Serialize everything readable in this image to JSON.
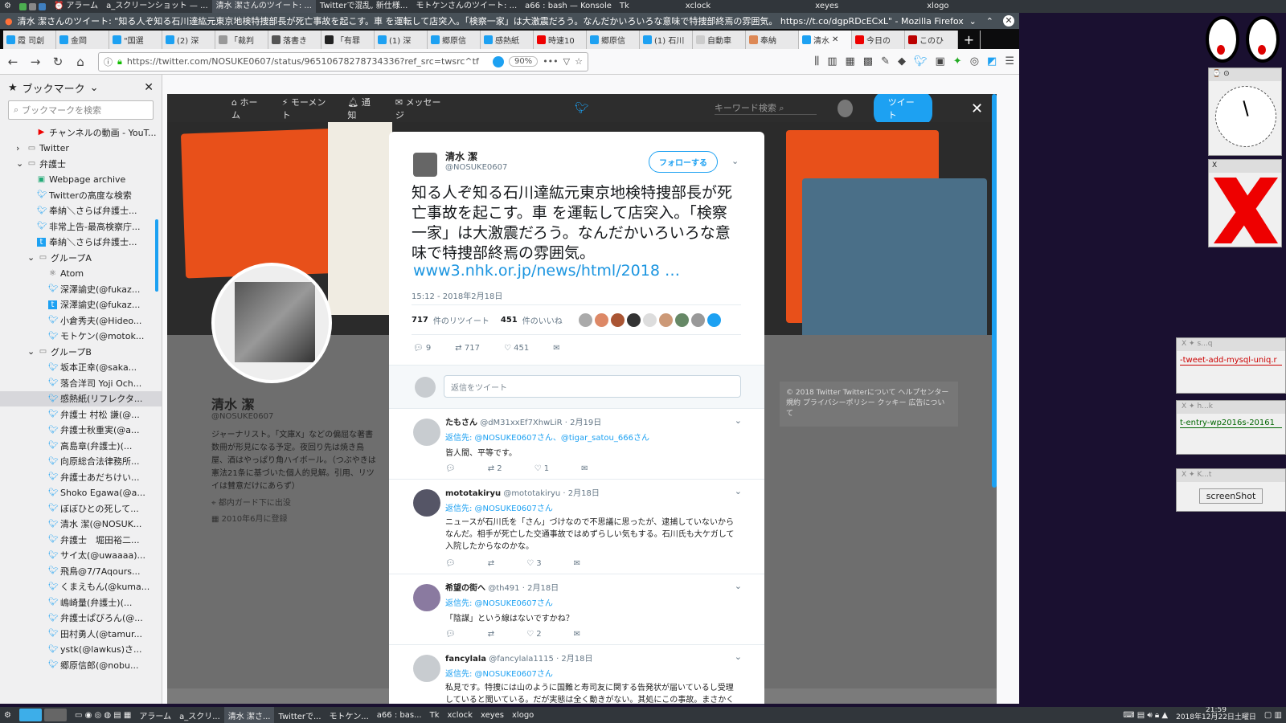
{
  "system_panel": {
    "items": [
      "アラーム",
      "a_スクリーンショット — ...",
      "清水 潔さんのツイート: ...",
      "Twitterで混乱, 新仕様...",
      "モトケンさんのツイート: ...",
      "a66 : bash — Konsole",
      "Tk",
      "xclock",
      "xeyes",
      "xlogo"
    ]
  },
  "window": {
    "title": "清水 潔さんのツイート: \"知る人ぞ知る石川達紘元東京地検特捜部長が死亡事故を起こす。車 を運転して店突入。「検察一家」は大激震だろう。なんだかいろいろな意味で特捜部終焉の雰囲気。 https://t.co/dgpRDcECxL\" - Mozilla Firefox"
  },
  "tabs": [
    "霞 司創",
    "金岡",
    "\"国選",
    "(2) 深",
    "「裁判",
    "落書き",
    "「有罪",
    "(1) 深",
    "郷原信",
    "感熱紙",
    "時速10",
    "郷原信",
    "(1) 石川",
    "自動車",
    "奉納",
    "清水",
    "今日の",
    "このひ"
  ],
  "navbar": {
    "url": "https://twitter.com/NOSUKE0607/status/965106782787343​36?ref_src=twsrc^tf",
    "zoom": "90%"
  },
  "sidebar": {
    "title": "ブックマーク",
    "search_placeholder": "ブックマークを検索",
    "items": [
      {
        "label": "チャンネルの動画 - YouT...",
        "indent": 3,
        "icon": "youtube"
      },
      {
        "label": "Twitter",
        "indent": 2,
        "icon": "folder"
      },
      {
        "label": "弁護士",
        "indent": 2,
        "icon": "folder-open"
      },
      {
        "label": "Webpage archive",
        "indent": 3,
        "icon": "archive"
      },
      {
        "label": "Twitterの高度な検索",
        "indent": 3,
        "icon": "twitter"
      },
      {
        "label": "奉納＼さらば弁護士...",
        "indent": 3,
        "icon": "twitter"
      },
      {
        "label": "非常上告-最高検察庁...",
        "indent": 3,
        "icon": "twitter"
      },
      {
        "label": "奉納＼さらば弁護士...",
        "indent": 3,
        "icon": "t"
      },
      {
        "label": "グループA",
        "indent": 3,
        "icon": "folder-open"
      },
      {
        "label": "Atom",
        "indent": 4,
        "icon": "atom"
      },
      {
        "label": "深澤諭史(@fukaz...",
        "indent": 4,
        "icon": "twitter"
      },
      {
        "label": "深澤諭史(@fukaz...",
        "indent": 4,
        "icon": "t"
      },
      {
        "label": "小倉秀夫(@Hideo...",
        "indent": 4,
        "icon": "twitter"
      },
      {
        "label": "モトケン(@motok...",
        "indent": 4,
        "icon": "twitter"
      },
      {
        "label": "グループB",
        "indent": 3,
        "icon": "folder-open"
      },
      {
        "label": "坂本正幸(@saka...",
        "indent": 4,
        "icon": "twitter"
      },
      {
        "label": "落合洋司 Yoji Och...",
        "indent": 4,
        "icon": "twitter"
      },
      {
        "label": "感熱紙(リフレクタ...",
        "indent": 4,
        "icon": "twitter",
        "selected": true
      },
      {
        "label": "弁護士 村松 謙(@...",
        "indent": 4,
        "icon": "twitter"
      },
      {
        "label": "弁護士秋重実(@a...",
        "indent": 4,
        "icon": "twitter"
      },
      {
        "label": "高島章(弁護士)(...",
        "indent": 4,
        "icon": "twitter"
      },
      {
        "label": "向原総合法律務所...",
        "indent": 4,
        "icon": "twitter"
      },
      {
        "label": "弁護士あだちけい...",
        "indent": 4,
        "icon": "twitter"
      },
      {
        "label": "Shoko Egawa(@a...",
        "indent": 4,
        "icon": "twitter"
      },
      {
        "label": "ぼぼひとの死して...",
        "indent": 4,
        "icon": "twitter"
      },
      {
        "label": "清水 潔(@NOSUK...",
        "indent": 4,
        "icon": "twitter"
      },
      {
        "label": "弁護士　堀田裕二...",
        "indent": 4,
        "icon": "twitter"
      },
      {
        "label": "サイ太(@uwaaaa)...",
        "indent": 4,
        "icon": "twitter"
      },
      {
        "label": "飛鳥@7/7Aqours...",
        "indent": 4,
        "icon": "twitter"
      },
      {
        "label": "くまえもん(@kuma...",
        "indent": 4,
        "icon": "twitter"
      },
      {
        "label": "嶋崎量(弁護士)(...",
        "indent": 4,
        "icon": "twitter"
      },
      {
        "label": "弁護士ぱびろん(@...",
        "indent": 4,
        "icon": "twitter"
      },
      {
        "label": "田村勇人(@tamur...",
        "indent": 4,
        "icon": "twitter"
      },
      {
        "label": "ystk(@lawkus)さ...",
        "indent": 4,
        "icon": "twitter"
      },
      {
        "label": "郷原信郎(@nobu...",
        "indent": 4,
        "icon": "twitter"
      }
    ]
  },
  "twitter_nav": {
    "home": "ホーム",
    "moments": "モーメント",
    "notifications": "通知",
    "messages": "メッセージ",
    "search_placeholder": "キーワード検索",
    "tweet_button": "ツイート"
  },
  "profile": {
    "name": "清水 潔",
    "handle": "@NOSUKE0607",
    "bio": "ジャーナリスト。「文庫X」などの偏屈な著書数冊が形見になる予定。夜回り先は焼き鳥屋、酒はやっぱり角ハイボール。（つぶやきは憲法21条に基づいた個人的見解。引用、リツイは賛意だけにあらず）",
    "location": "都内ガード下に出没",
    "joined": "2010年6月に登録",
    "footer": "© 2018 Twitter  Twitterについて  ヘルプセンター  規約  プライバシーポリシー  クッキー  広告について"
  },
  "tweet": {
    "author": "清水 潔",
    "handle": "@NOSUKE0607",
    "follow_label": "フォローする",
    "text": "知る人ぞ知る石川達紘元東京地検特捜部長が死亡事故を起こす。車 を運転して店突入。「検察一家」は大激震だろう。なんだかいろいろな意味で特捜部終焉の雰囲気。",
    "link": "www3.nhk.or.jp/news/html/2018 …",
    "timestamp": "15:12 - 2018年2月18日",
    "retweets": "717",
    "retweets_label": "件のリツイート",
    "likes": "451",
    "likes_label": "件のいいね",
    "reply_count": "9",
    "rt_count": "717",
    "like_count": "451",
    "reply_placeholder": "返信をツイート"
  },
  "replies": [
    {
      "name": "たもさん",
      "handle": "@dM31xxEf7XhwLiR",
      "date": "· 2月19日",
      "to": "返信先: @NOSUKE0607さん、@tigar_satou_666さん",
      "text": "皆人間、平等です。",
      "rt": "2",
      "like": "1"
    },
    {
      "name": "mototakiryu",
      "handle": "@mototakiryu",
      "date": "· 2月18日",
      "to": "返信先: @NOSUKE0607さん",
      "text": "ニュースが石川氏を「さん」づけなので不思議に思ったが、逮捕していないからなんだ。相手が死亡した交通事故ではめずらしい気もする。石川氏も大ケガして入院したからなのかな。",
      "rt": "",
      "like": "3"
    },
    {
      "name": "希望の街へ",
      "handle": "@th491",
      "date": "· 2月18日",
      "to": "返信先: @NOSUKE0607さん",
      "text": "「陰謀」という線はないですかね？",
      "rt": "",
      "like": "2"
    },
    {
      "name": "fancylala",
      "handle": "@fancylala1115",
      "date": "· 2月18日",
      "to": "返信先: @NOSUKE0607さん",
      "text": "私見です。特捜には山のように国難と寿司友に関する告発状が届いているし受理していると聞いている。だが実態は全く動きがない。其処にこの事故。まさかく特捜は解体されるのでは",
      "rt": "",
      "like": ""
    }
  ],
  "desktop": {
    "win1_title": "s...q",
    "win1_text": "-tweet-add-mysql-uniq.r",
    "win2_title": "h...k",
    "win2_text": "t-entry-wp2016s-20161",
    "win3_title": "K...t",
    "win3_button": "screenShot"
  },
  "bottom_panel": {
    "items": [
      "アラーム",
      "a_スクリ...",
      "清水 潔さ...",
      "Twitterで...",
      "モトケン...",
      "a66 : bas...",
      "Tk",
      "xclock",
      "xeyes",
      "xlogo"
    ],
    "time": "21:59",
    "date": "2018年12月22日土曜日"
  },
  "colors": {
    "twitter_blue": "#1da1f2",
    "link_blue": "#1b95e0",
    "panel": "#31363b"
  }
}
